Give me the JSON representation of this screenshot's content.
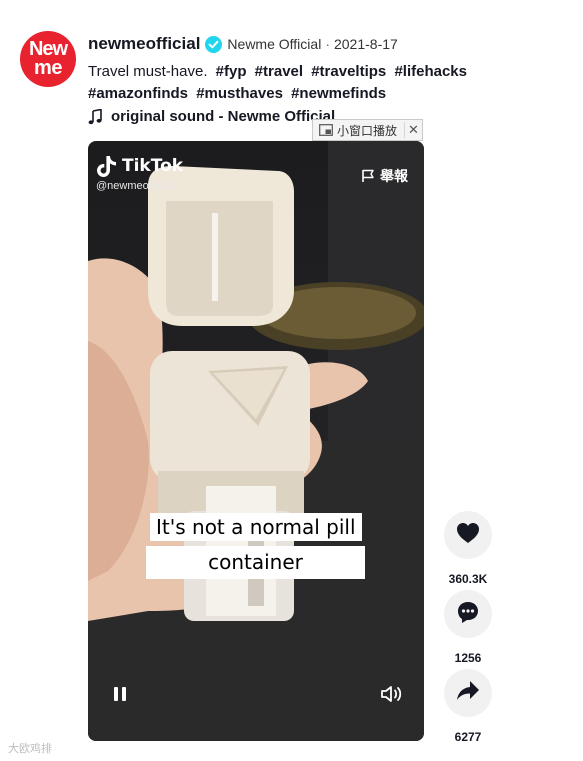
{
  "avatar": {
    "line1": "New",
    "line2": "me",
    "bg": "#e8232f"
  },
  "author": {
    "username": "newmeofficial",
    "verified_icon": "verified-badge-icon",
    "nickname": "Newme Official",
    "separator": "·",
    "date": "2021-8-17"
  },
  "description": {
    "text": "Travel must-have.",
    "hashtags": [
      "#fyp",
      "#travel",
      "#traveltips",
      "#lifehacks",
      "#amazonfinds",
      "#musthaves",
      "#newmefinds"
    ]
  },
  "music": {
    "icon": "music-note-icon",
    "label": "original sound - Newme Official"
  },
  "pip_popup": {
    "label": "小窗口播放",
    "close": "✕"
  },
  "video": {
    "watermark_brand": "TikTok",
    "watermark_handle": "@newmeofficial",
    "report_label": "舉報",
    "caption_line1": "It's not a normal pill",
    "caption_line2": "container"
  },
  "actions": {
    "likes": "360.3K",
    "comments": "1256",
    "shares": "6277"
  },
  "site_watermark": "大欧鸡排",
  "colors": {
    "accent_red": "#e8232f",
    "verified_blue": "#20d5ec",
    "text": "#161823",
    "action_bg": "#f1f1f2"
  }
}
